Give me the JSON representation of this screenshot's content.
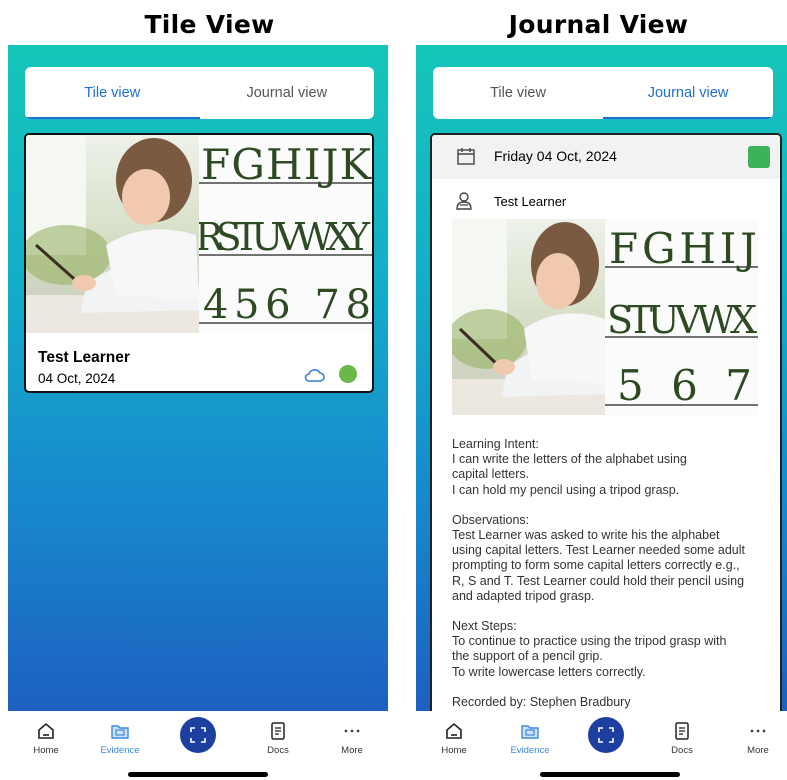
{
  "headings": {
    "left": "Tile View",
    "right": "Journal View"
  },
  "tabs": {
    "tile": "Tile view",
    "journal": "Journal view"
  },
  "tile_card": {
    "learner": "Test Learner",
    "date": "04 Oct, 2024"
  },
  "journal": {
    "date": "Friday 04 Oct, 2024",
    "learner": "Test Learner",
    "learning_intent": {
      "label": "Learning Intent:",
      "lines": [
        "I can write the letters of the alphabet using",
        "capital letters.",
        "I can hold my pencil using a tripod grasp."
      ]
    },
    "observations": {
      "label": "Observations:",
      "lines": [
        "Test Learner was asked to write his the alphabet",
        "using capital letters. Test Learner needed some adult",
        "prompting to form some capital letters correctly e.g.,",
        "R, S and T. Test Learner could hold their pencil using",
        "and adapted tripod grasp."
      ]
    },
    "next_steps": {
      "label": "Next Steps:",
      "lines": [
        "To continue to practice using the tripod grasp with",
        "the support of a pencil grip.",
        "To write lowercase letters correctly."
      ]
    },
    "recorded_by": "Recorded by: Stephen Bradbury"
  },
  "writing_sample": {
    "tile_rows": [
      "FGHIJK",
      "RSTUVWXY",
      "456 78"
    ],
    "journal_rows": [
      "FGHIJ",
      "STUVWX",
      "567"
    ]
  },
  "nav": {
    "home": "Home",
    "evidence": "Evidence",
    "docs": "Docs",
    "more": "More"
  },
  "colors": {
    "accent": "#1e6fd0",
    "scan_button": "#1d3fa0",
    "status_green": "#3cb35a",
    "gradient_top": "#15c6b8",
    "gradient_bottom": "#1d60c0"
  },
  "icons": [
    "calendar-icon",
    "person-icon",
    "cloud-icon",
    "home-icon",
    "evidence-icon",
    "scan-icon",
    "docs-icon",
    "more-icon"
  ]
}
